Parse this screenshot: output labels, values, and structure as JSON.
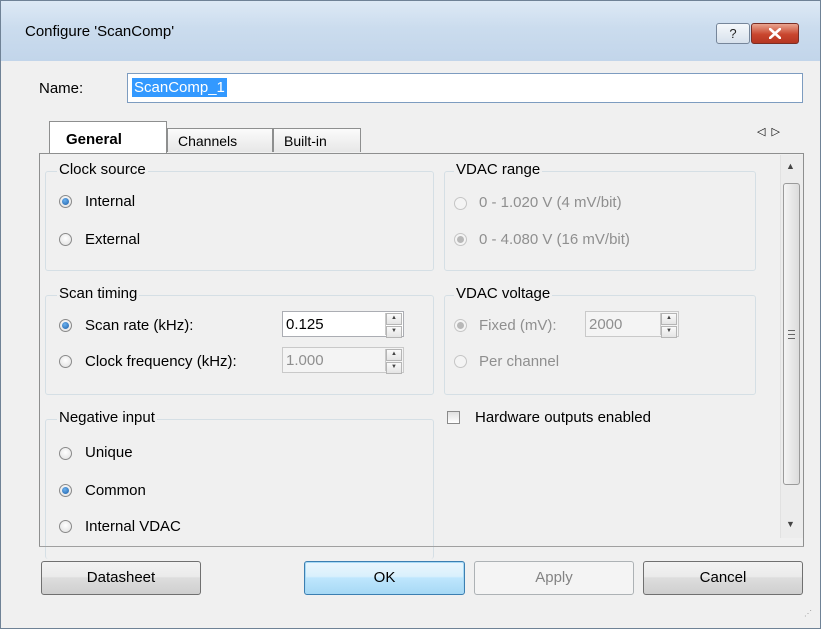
{
  "window": {
    "title": "Configure 'ScanComp'",
    "help_glyph": "?"
  },
  "name_field": {
    "label": "Name:",
    "value": "ScanComp_1"
  },
  "tabs": [
    {
      "label": "General",
      "active": true
    },
    {
      "label": "Channels",
      "active": false
    },
    {
      "label": "Built-in",
      "active": false
    }
  ],
  "tab_scroll": {
    "left": "◁",
    "right": "▷"
  },
  "clock_source": {
    "title": "Clock source",
    "options": [
      {
        "label": "Internal",
        "selected": true
      },
      {
        "label": "External",
        "selected": false
      }
    ]
  },
  "vdac_range": {
    "title": "VDAC range",
    "options": [
      {
        "label": "0 - 1.020 V (4 mV/bit)",
        "selected": false,
        "enabled": false
      },
      {
        "label": "0 - 4.080 V (16 mV/bit)",
        "selected": true,
        "enabled": false
      }
    ]
  },
  "scan_timing": {
    "title": "Scan timing",
    "scan_rate": {
      "label": "Scan rate (kHz):",
      "value": "0.125",
      "selected": true
    },
    "clock_freq": {
      "label": "Clock frequency (kHz):",
      "value": "1.000",
      "selected": false
    }
  },
  "vdac_voltage": {
    "title": "VDAC voltage",
    "fixed": {
      "label": "Fixed (mV):",
      "value": "2000",
      "selected": true,
      "enabled": false
    },
    "per_channel": {
      "label": "Per channel",
      "selected": false,
      "enabled": false
    }
  },
  "negative_input": {
    "title": "Negative input",
    "options": [
      {
        "label": "Unique",
        "selected": false
      },
      {
        "label": "Common",
        "selected": true
      },
      {
        "label": "Internal VDAC",
        "selected": false
      }
    ]
  },
  "hardware_outputs": {
    "label": "Hardware outputs enabled",
    "checked": false
  },
  "buttons": {
    "datasheet": "Datasheet",
    "ok": "OK",
    "apply": "Apply",
    "cancel": "Cancel"
  },
  "colors": {
    "accent": "#3399ff",
    "close_button": "#c9462e",
    "title_gradient": "#cbdcee"
  },
  "icons": {
    "close": "close-icon",
    "help": "help-icon",
    "scroll_up": "scroll-up-icon",
    "scroll_down": "scroll-down-icon"
  }
}
